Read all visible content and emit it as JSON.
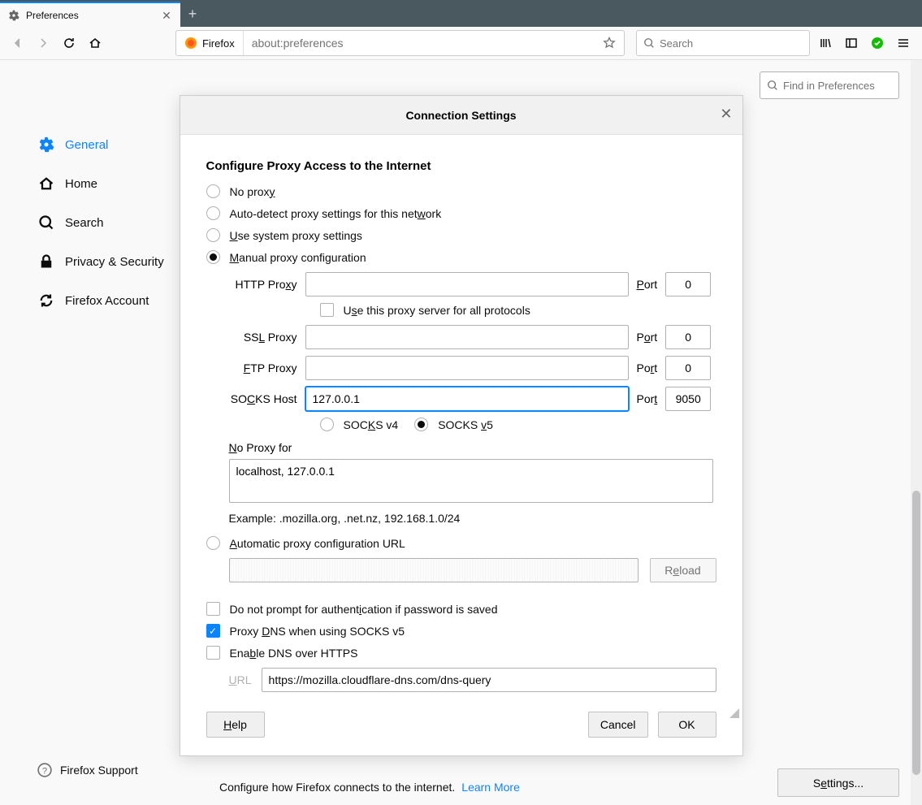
{
  "tab": {
    "title": "Preferences"
  },
  "toolbar": {
    "identity_label": "Firefox",
    "url": "about:preferences",
    "search_placeholder": "Search"
  },
  "sidebar": {
    "items": [
      "General",
      "Home",
      "Search",
      "Privacy & Security",
      "Firefox Account"
    ],
    "support": "Firefox Support"
  },
  "find_placeholder": "Find in Preferences",
  "bottom": {
    "text": "Configure how Firefox connects to the internet.",
    "learn": "Learn More",
    "settings_label": "Settings..."
  },
  "dialog": {
    "title": "Connection Settings",
    "section": "Configure Proxy Access to the Internet",
    "radios": {
      "none": "No proxy",
      "auto": "Auto-detect proxy settings for this network",
      "system": "Use system proxy settings",
      "manual": "Manual proxy configuration",
      "pac": "Automatic proxy configuration URL"
    },
    "fields": {
      "http": {
        "label": "HTTP Proxy",
        "value": "",
        "port": "0"
      },
      "useAll": "Use this proxy server for all protocols",
      "ssl": {
        "label": "SSL Proxy",
        "value": "",
        "port": "0"
      },
      "ftp": {
        "label": "FTP Proxy",
        "value": "",
        "port": "0"
      },
      "socks": {
        "label": "SOCKS Host",
        "value": "127.0.0.1",
        "port": "9050"
      },
      "portLabel": "Port",
      "socks_v4": "SOCKS v4",
      "socks_v5": "SOCKS v5",
      "noproxy_label": "No Proxy for",
      "noproxy_value": "localhost, 127.0.0.1",
      "example": "Example: .mozilla.org, .net.nz, 192.168.1.0/24",
      "reload": "Reload"
    },
    "checks": {
      "noPrompt": "Do not prompt for authentication if password is saved",
      "proxyDns": "Proxy DNS when using SOCKS v5",
      "doH": "Enable DNS over HTTPS",
      "urlLabel": "URL",
      "dohUrl": "https://mozilla.cloudflare-dns.com/dns-query"
    },
    "buttons": {
      "help": "Help",
      "cancel": "Cancel",
      "ok": "OK"
    }
  }
}
